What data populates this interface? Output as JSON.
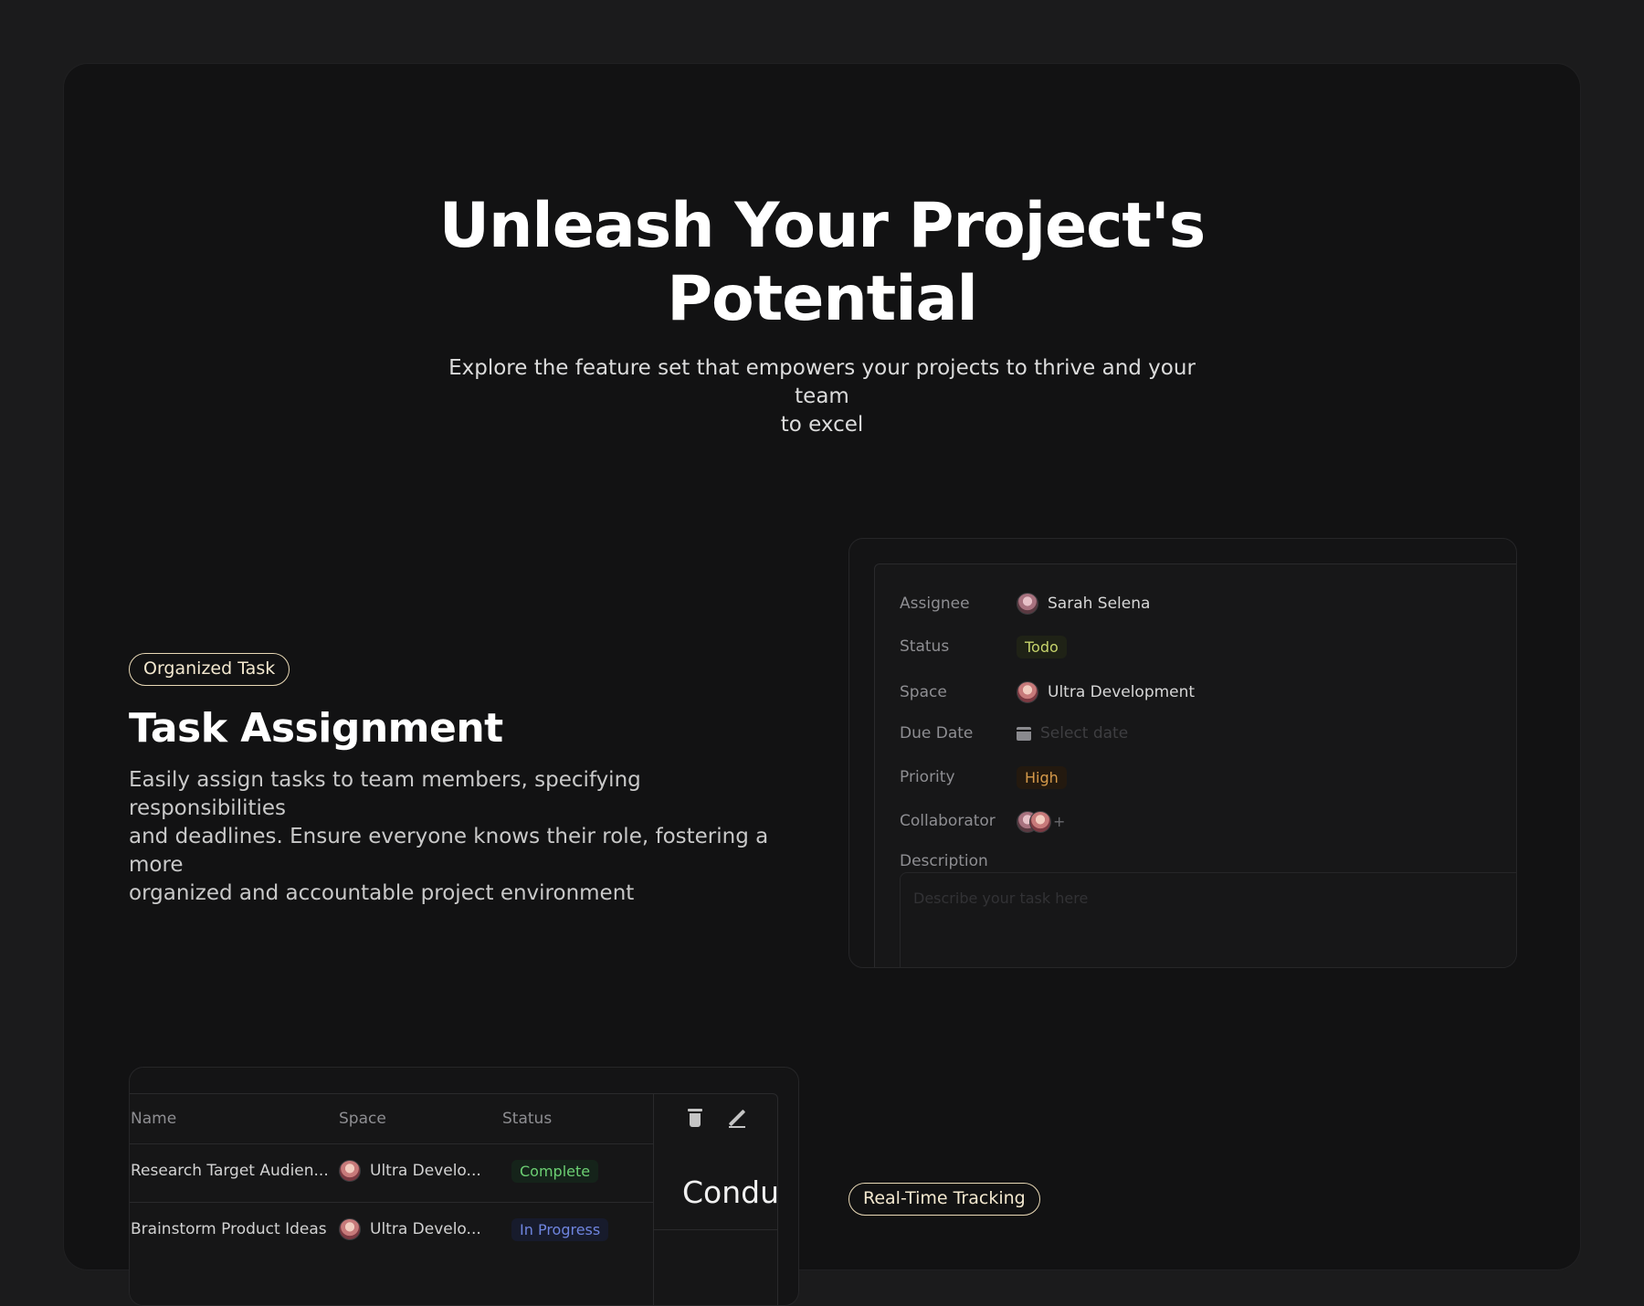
{
  "hero": {
    "title_line1": "Unleash Your Project's",
    "title_line2": "Potential",
    "subtitle_line1": "Explore the feature set that empowers your projects to thrive and your team",
    "subtitle_line2": "to excel"
  },
  "feature_task": {
    "tag": "Organized Task",
    "title": "Task Assignment",
    "desc_line1": "Easily assign tasks to team members, specifying responsibilities",
    "desc_line2": "and deadlines. Ensure everyone knows their role, fostering a more",
    "desc_line3": "organized and accountable project environment"
  },
  "task_form": {
    "assignee_label": "Assignee",
    "assignee_value": "Sarah Selena",
    "status_label": "Status",
    "status_value": "Todo",
    "space_label": "Space",
    "space_value": "Ultra Development",
    "due_label": "Due Date",
    "due_placeholder": "Select date",
    "priority_label": "Priority",
    "priority_value": "High",
    "collab_label": "Collaborator",
    "collab_add": "+",
    "description_label": "Description",
    "description_placeholder": "Describe your task here"
  },
  "task_table": {
    "col_name": "Name",
    "col_space": "Space",
    "col_status": "Status",
    "rows": [
      {
        "name": "Research Target Audien...",
        "space": "Ultra Develo...",
        "status": "Complete"
      },
      {
        "name": "Brainstorm Product Ideas",
        "space": "Ultra Develo...",
        "status": "In Progress"
      }
    ],
    "side_title": "Condu"
  },
  "feature_tracking": {
    "tag": "Real-Time Tracking"
  },
  "colors": {
    "background": "#1b1b1c",
    "panel": "#121213",
    "tag_border": "#e9d9b6",
    "status_todo": "#c6d36b",
    "priority_high": "#d69a4a",
    "status_complete": "#6ccf73",
    "status_in_progress": "#6f85df"
  }
}
